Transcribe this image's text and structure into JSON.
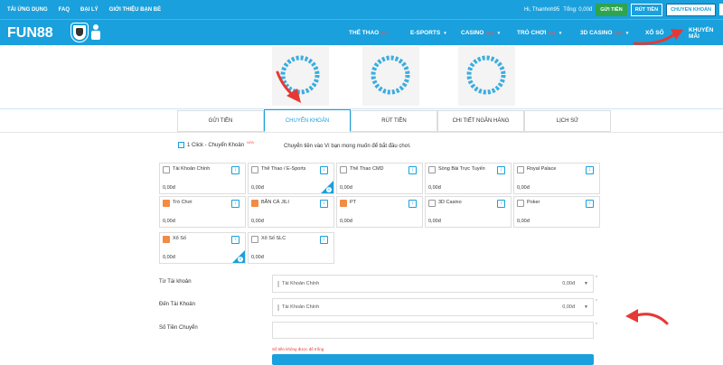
{
  "topbar": {
    "links": [
      "TẢI ỨNG DỤNG",
      "FAQ",
      "ĐẠI LÝ",
      "GIỚI THIỆU BẠN BÈ"
    ],
    "greeting": "Hi, Thanhnh95",
    "balance": "Tổng: 0,00đ",
    "deposit": "GỬI TIỀN",
    "withdraw": "RÚT TIỀN",
    "transfer": "CHUYỂN KHOẢN"
  },
  "nav": {
    "logo": "FUN88",
    "items": [
      {
        "label": "THỂ THAO",
        "tag": "HOT"
      },
      {
        "label": "E-SPORTS",
        "tag": ""
      },
      {
        "label": "CASINO",
        "tag": "NEW"
      },
      {
        "label": "TRÒ CHƠI",
        "tag": "HOT"
      },
      {
        "label": "3D CASINO",
        "tag": "NEW"
      },
      {
        "label": "XỔ SỐ",
        "tag": ""
      },
      {
        "label": "KHUYẾN MÃI",
        "tag": ""
      }
    ]
  },
  "tabs": [
    "GỬI TIỀN",
    "CHUYỂN KHOẢN",
    "RÚT TIỀN",
    "CHI TIẾT NGÂN HÀNG",
    "LỊCH SỬ"
  ],
  "active_tab": "CHUYỂN KHOẢN",
  "oneclick": {
    "label": "1 Click - Chuyển Khoản",
    "tag": "NEW"
  },
  "transfer_message": "Chuyển tiền vào Ví bạn mong muốn để bắt đầu chơi.",
  "wallets": [
    {
      "name": "Tài Khoản Chính",
      "amount": "0,00đ"
    },
    {
      "name": "Thể Thao / E-Sports",
      "amount": "0,00đ"
    },
    {
      "name": "Thể Thao CMD",
      "amount": "0,00đ"
    },
    {
      "name": "Sòng Bài Trực Tuyến",
      "amount": "0,00đ"
    },
    {
      "name": "Royal Palace",
      "amount": "0,00đ"
    },
    {
      "name": "Trò Chơi",
      "amount": "0,00đ"
    },
    {
      "name": "BẮN CÁ JILI",
      "amount": "0,00đ"
    },
    {
      "name": "PT",
      "amount": "0,00đ"
    },
    {
      "name": "3D Casino",
      "amount": "0,00đ"
    },
    {
      "name": "Poker",
      "amount": "0,00đ"
    },
    {
      "name": "Xổ Số",
      "amount": "0,00đ"
    },
    {
      "name": "Xổ Số SLC",
      "amount": "0,00đ"
    }
  ],
  "form": {
    "from_label": "Từ Tài khoản",
    "from_value": "Tài Khoản Chính",
    "from_amount": "0,00đ",
    "to_label": "Đến Tài Khoản",
    "to_value": "Tài Khoản Chính",
    "to_amount": "0,00đ",
    "amount_label": "Số Tiền Chuyển",
    "amount_value": "",
    "error": "Số tiền không được để trống",
    "required_mark": "*"
  },
  "colors": {
    "brand": "#1aa0dc",
    "accent_red": "#e53935",
    "deposit_green": "#2ea44f"
  }
}
